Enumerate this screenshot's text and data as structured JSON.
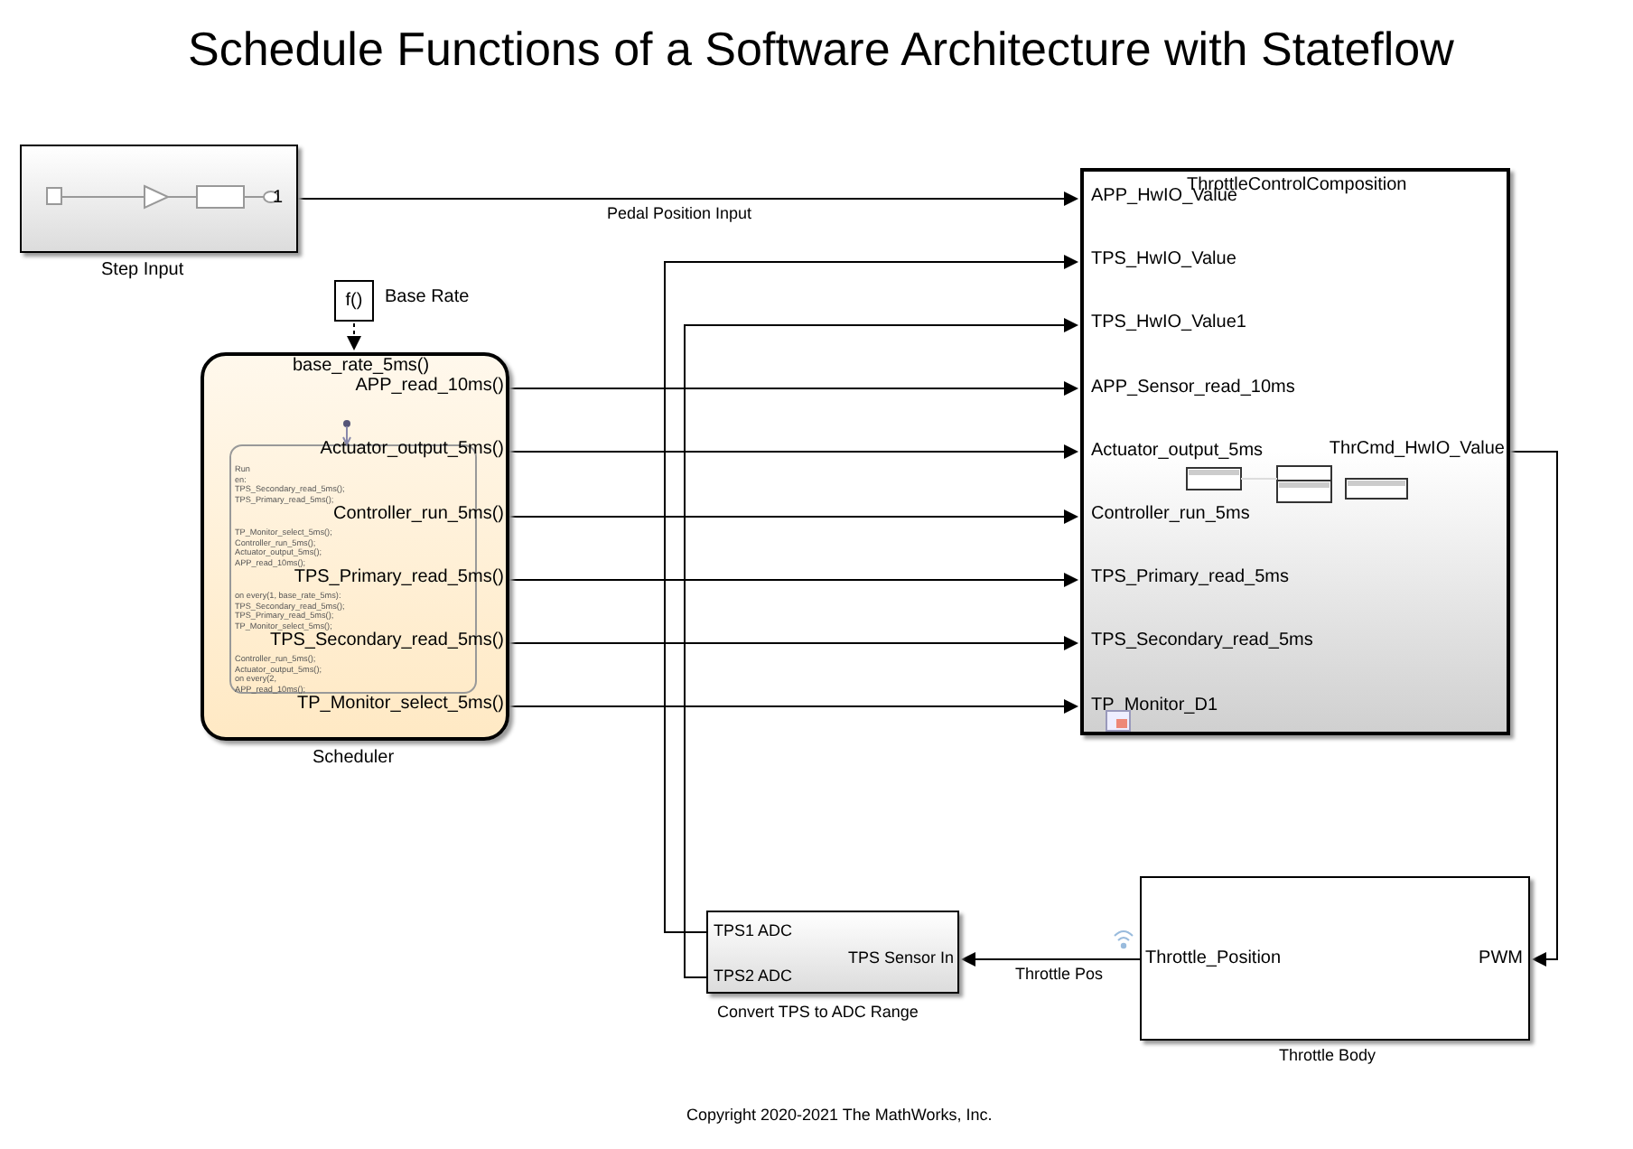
{
  "title": "Schedule Functions of a Software Architecture with Stateflow",
  "step_input": {
    "name": "Step Input",
    "port": "1",
    "signal": "Pedal Position Input"
  },
  "base_rate": {
    "symbol": "f()",
    "name": "Base Rate"
  },
  "scheduler": {
    "name": "Scheduler",
    "trigger": "base_rate_5ms()",
    "outputs": [
      "APP_read_10ms()",
      "Actuator_output_5ms()",
      "Controller_run_5ms()",
      "TPS_Primary_read_5ms()",
      "TPS_Secondary_read_5ms()",
      "TP_Monitor_select_5ms()"
    ],
    "state_lines": [
      "Run",
      "en:",
      "TPS_Secondary_read_5ms();",
      "TPS_Primary_read_5ms();",
      "TP_Monitor_select_5ms();",
      "Controller_run_5ms();",
      "Actuator_output_5ms();",
      "APP_read_10ms();",
      "on every(1, base_rate_5ms):",
      "TPS_Secondary_read_5ms();",
      "TPS_Primary_read_5ms();",
      "TP_Monitor_select_5ms();",
      "Controller_run_5ms();",
      "Actuator_output_5ms();",
      "on every(2,",
      "APP_read_10ms();"
    ]
  },
  "composition": {
    "name": "ThrottleControlComposition",
    "inputs": [
      "APP_HwIO_Value",
      "TPS_HwIO_Value",
      "TPS_HwIO_Value1",
      "APP_Sensor_read_10ms",
      "Actuator_output_5ms",
      "Controller_run_5ms",
      "TPS_Primary_read_5ms",
      "TPS_Secondary_read_5ms",
      "TP_Monitor_D1"
    ],
    "output": "ThrCmd_HwIO_Value"
  },
  "convert": {
    "name": "Convert TPS to ADC Range",
    "outputs": [
      "TPS1 ADC",
      "TPS2 ADC"
    ],
    "input": "TPS Sensor In"
  },
  "throttle_signal": "Throttle Pos",
  "throttle_body": {
    "name": "Throttle Body",
    "output": "Throttle_Position",
    "input": "PWM"
  },
  "copyright": "Copyright 2020-2021 The MathWorks, Inc."
}
